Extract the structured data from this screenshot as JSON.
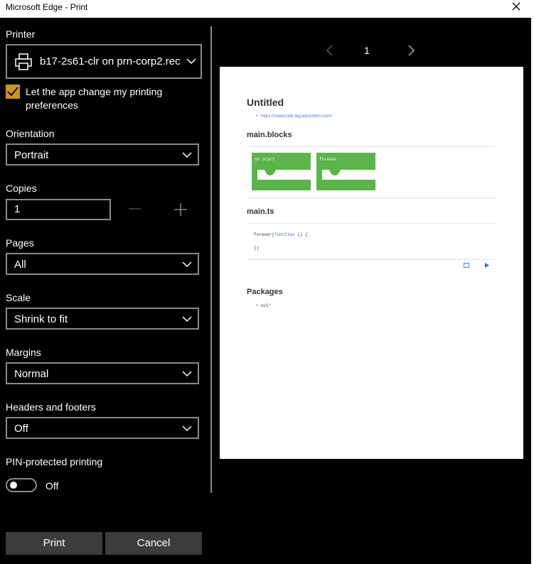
{
  "window": {
    "title": "Microsoft Edge - Print"
  },
  "settings": {
    "printer": {
      "label": "Printer",
      "value": "b17-2s61-clr on prn-corp2.rec"
    },
    "app_pref": {
      "label": "Let the app change my printing preferences",
      "checked": true
    },
    "orientation": {
      "label": "Orientation",
      "value": "Portrait"
    },
    "copies": {
      "label": "Copies",
      "value": "1"
    },
    "pages": {
      "label": "Pages",
      "value": "All"
    },
    "scale": {
      "label": "Scale",
      "value": "Shrink to fit"
    },
    "margins": {
      "label": "Margins",
      "value": "Normal"
    },
    "headers_footers": {
      "label": "Headers and footers",
      "value": "Off"
    },
    "pin": {
      "label": "PIN-protected printing",
      "state": "Off"
    }
  },
  "buttons": {
    "print": "Print",
    "cancel": "Cancel"
  },
  "preview": {
    "page_number": "1",
    "doc": {
      "title": "Untitled",
      "link": "https://makecode.legoeducation.com/",
      "blocks_heading": "main.blocks",
      "blocks": [
        "on start",
        "forever"
      ],
      "ts_heading": "main.ts",
      "code_line1_a": "forever(",
      "code_line1_b": "function",
      "code_line1_c": " () {",
      "code_line2": "})",
      "packages_heading": "Packages",
      "package": "ev3.*"
    }
  },
  "colors": {
    "accent": "#c8961e",
    "block_green": "#5cb44a",
    "control_border": "#8a8a8a",
    "button_bg": "#3c3c3c"
  }
}
